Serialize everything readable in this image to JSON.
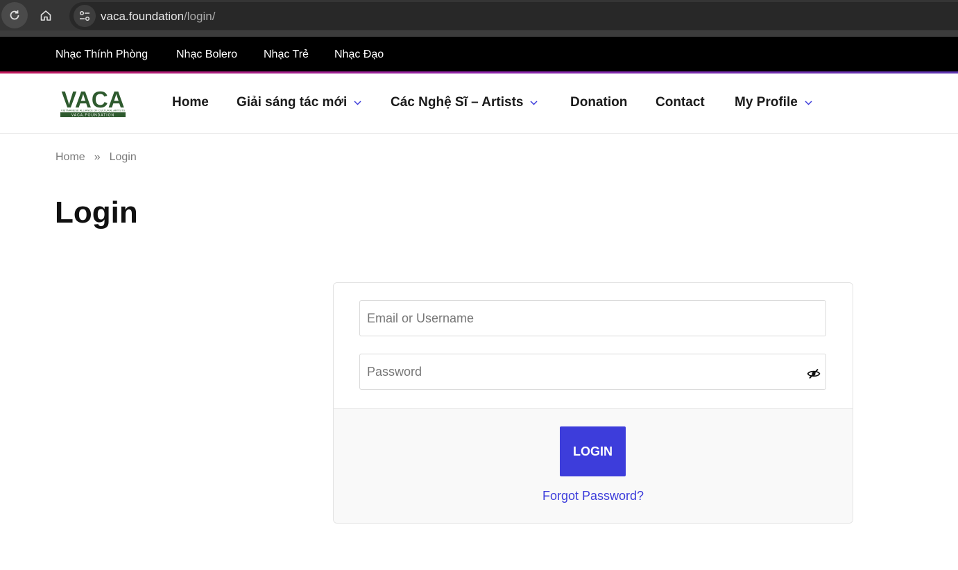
{
  "browser": {
    "url_domain": "vaca.foundation",
    "url_path": "/login/"
  },
  "topbar": {
    "links": [
      "Nhạc Thính Phòng",
      "Nhạc Bolero",
      "Nhạc Trẻ",
      "Nhạc Đạo"
    ]
  },
  "header": {
    "logo": {
      "text": "VACA",
      "tagline": "VIETNAMESE ALLIANCE OF CULTURAL ARTISTS",
      "subtext": "VACA.FOUNDATION",
      "color": "#2e5a2e"
    },
    "nav": [
      {
        "label": "Home",
        "has_dropdown": false
      },
      {
        "label": "Giải sáng tác mới",
        "has_dropdown": true
      },
      {
        "label": "Các Nghệ Sĩ – Artists",
        "has_dropdown": true
      },
      {
        "label": "Donation",
        "has_dropdown": false
      },
      {
        "label": "Contact",
        "has_dropdown": false
      },
      {
        "label": "My Profile",
        "has_dropdown": true
      }
    ]
  },
  "breadcrumb": {
    "home": "Home",
    "separator": "»",
    "current": "Login"
  },
  "page_title": "Login",
  "login_form": {
    "email_placeholder": "Email or Username",
    "password_placeholder": "Password",
    "password_toggle_icon": "eye-slash-icon",
    "submit_label": "LOGIN",
    "forgot_label": "Forgot Password?",
    "accent_color": "#3d3ddb"
  }
}
